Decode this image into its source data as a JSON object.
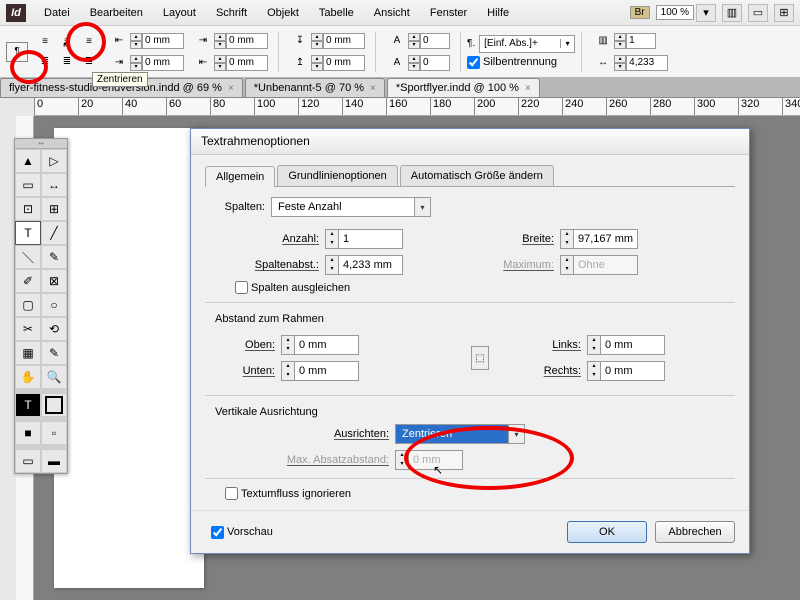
{
  "menu": [
    "Datei",
    "Bearbeiten",
    "Layout",
    "Schrift",
    "Objekt",
    "Tabelle",
    "Ansicht",
    "Fenster",
    "Hilfe"
  ],
  "zoom_value": "100 %",
  "br_badge": "Br",
  "control": {
    "left_indent": "0 mm",
    "tooltip": "Zentrieren",
    "style_combo": "[Einf. Abs.]+",
    "hyphenation": "Silbentrennung",
    "cols_field": "1",
    "gutter_field": "4,233"
  },
  "tabs": [
    {
      "label": "flyer-fitness-studio-endversion.indd @ 69 %",
      "active": false
    },
    {
      "label": "*Unbenannt-5 @ 70 %",
      "active": false
    },
    {
      "label": "*Sportflyer.indd @ 100 %",
      "active": true
    }
  ],
  "ruler_ticks": [
    0,
    20,
    40,
    60,
    80,
    100,
    120,
    140,
    160,
    180,
    200,
    220,
    240,
    260,
    280,
    300,
    320,
    340
  ],
  "dialog": {
    "title": "Textrahmenoptionen",
    "tabs": [
      "Allgemein",
      "Grundlinienoptionen",
      "Automatisch Größe ändern"
    ],
    "spalten_lbl": "Spalten:",
    "spalten_val": "Feste Anzahl",
    "anzahl_lbl": "Anzahl:",
    "anzahl_val": "1",
    "breite_lbl": "Breite:",
    "breite_val": "97,167 mm",
    "abst_lbl": "Spaltenabst.:",
    "abst_val": "4,233 mm",
    "max_lbl": "Maximum:",
    "max_val": "Ohne",
    "balance": "Spalten ausgleichen",
    "abstand_group": "Abstand zum Rahmen",
    "oben_lbl": "Oben:",
    "oben_val": "0 mm",
    "unten_lbl": "Unten:",
    "unten_val": "0 mm",
    "links_lbl": "Links:",
    "links_val": "0 mm",
    "rechts_lbl": "Rechts:",
    "rechts_val": "0 mm",
    "vert_group": "Vertikale Ausrichtung",
    "ausrichten_lbl": "Ausrichten:",
    "ausrichten_val": "Zentrieren",
    "maxabs_lbl": "Max. Absatzabstand:",
    "maxabs_val": "0 mm",
    "ignore": "Textumfluss ignorieren",
    "preview": "Vorschau",
    "ok": "OK",
    "cancel": "Abbrechen"
  }
}
